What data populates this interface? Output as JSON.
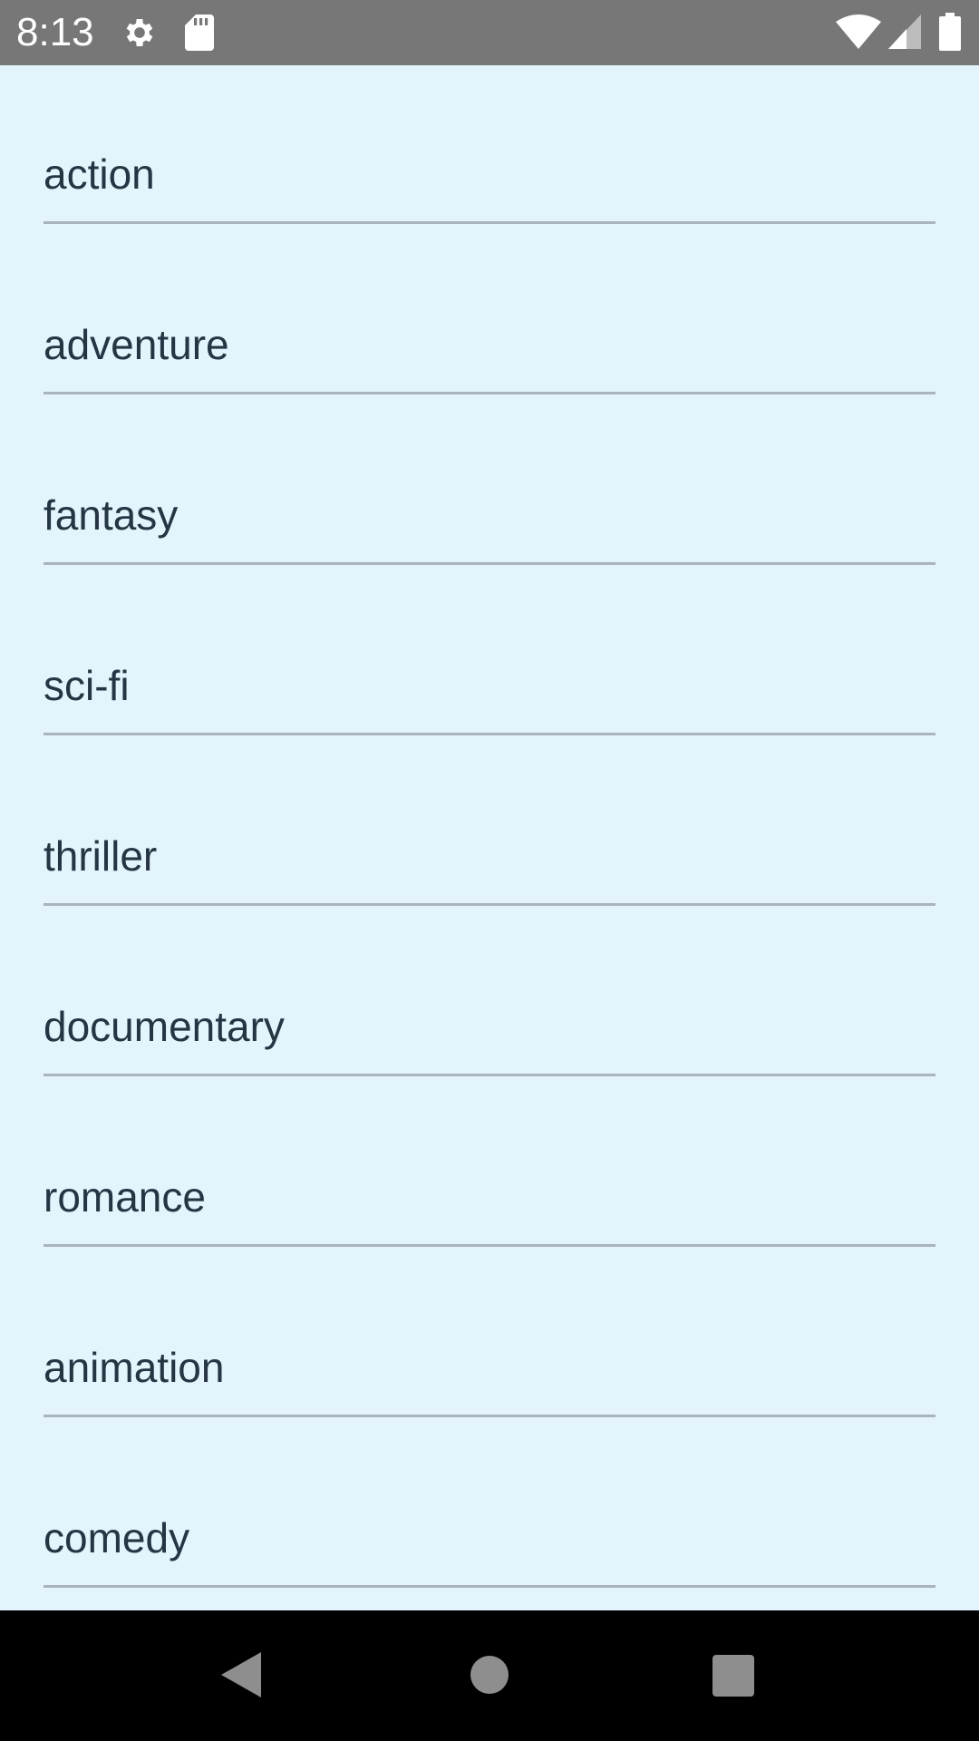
{
  "status_bar": {
    "time": "8:13",
    "icons": [
      "gear-icon",
      "sd-card-icon",
      "wifi-icon",
      "cell-signal-icon",
      "battery-icon"
    ]
  },
  "genres": [
    "action",
    "adventure",
    "fantasy",
    "sci-fi",
    "thriller",
    "documentary",
    "romance",
    "animation",
    "comedy"
  ],
  "nav_bar": {
    "buttons": [
      "back-icon",
      "home-icon",
      "recents-icon"
    ]
  },
  "colors": {
    "background": "#e3f4fc",
    "status_bar": "#777777",
    "text": "#263544",
    "divider": "#a9b4bd",
    "nav_bar": "#000000"
  }
}
